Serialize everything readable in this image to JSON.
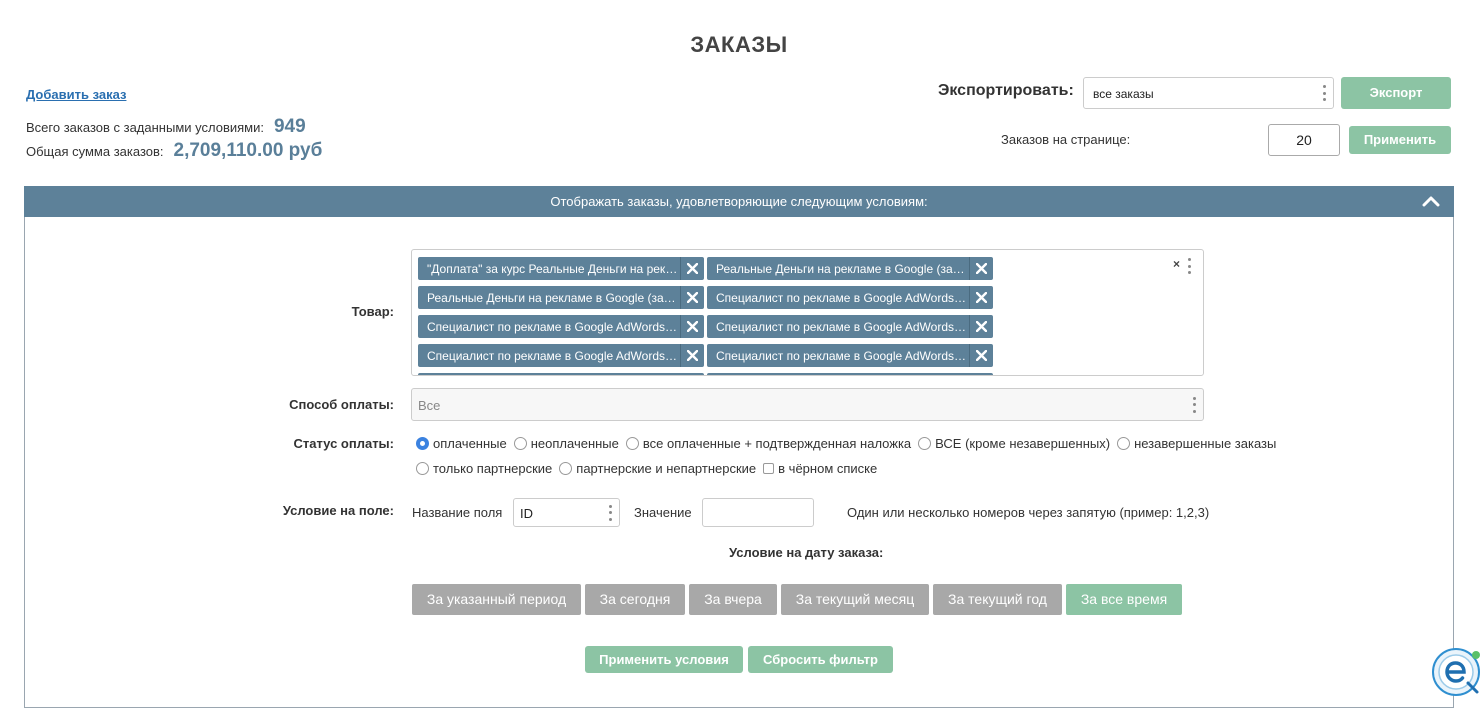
{
  "page": {
    "title": "ЗАКАЗЫ",
    "add_order_link": "Добавить заказ"
  },
  "stats": {
    "total_label": "Всего заказов с заданными условиями:",
    "total_value": "949",
    "sum_label": "Общая сумма заказов:",
    "sum_value": "2,709,110.00 руб"
  },
  "export": {
    "label": "Экспортировать:",
    "selected": "все заказы",
    "button": "Экспорт"
  },
  "per_page": {
    "label": "Заказов на странице:",
    "value": "20",
    "button": "Применить"
  },
  "filter": {
    "header": "Отображать заказы, удовлетворяющие следующим условиям:",
    "product_label": "Товар:",
    "product_tags": [
      "\"Доплата\" за курс Реальные Деньги на рекламе в Google",
      "Реальные Деньги на рекламе в Google (заочное обучение)",
      "Реальные Деньги на рекламе в Google (заочное обучение)",
      "Специалист по рекламе в Google AdWords (заочное обучение)",
      "Специалист по рекламе в Google AdWords (заочное обучение)",
      "Специалист по рекламе в Google AdWords (заочное обучение)",
      "Специалист по рекламе в Google AdWords (заочное обучение)",
      "Специалист по рекламе в Google AdWords (заочное обучение)"
    ],
    "payment_method_label": "Способ оплаты:",
    "payment_method_value": "Все",
    "payment_status_label": "Статус оплаты:",
    "payment_status_options": [
      "оплаченные",
      "неоплаченные",
      "все оплаченные + подтвержденная наложка",
      "ВСЕ (кроме незавершенных)",
      "незавершенные заказы",
      "только партнерские",
      "партнерские и непартнерские"
    ],
    "payment_status_selected": "оплаченные",
    "blacklist_label": "в чёрном списке",
    "field_condition_label": "Условие на поле:",
    "field_name_label": "Название поля",
    "field_name_value": "ID",
    "value_label": "Значение",
    "value_value": "",
    "hint": "Один или несколько номеров через запятую (пример: 1,2,3)",
    "date_condition_label": "Условие на дату заказа:",
    "periods": [
      "За указанный период",
      "За сегодня",
      "За вчера",
      "За текущий месяц",
      "За текущий год",
      "За все время"
    ],
    "active_period": "За все время",
    "apply_button": "Применить условия",
    "reset_button": "Сбросить фильтр"
  },
  "colors": {
    "header_bar": "#5d8199",
    "green_button": "#8cc4a4",
    "gray_button": "#a8a8a8",
    "stat_number": "#5a7f99",
    "link": "#2a6fb0"
  }
}
